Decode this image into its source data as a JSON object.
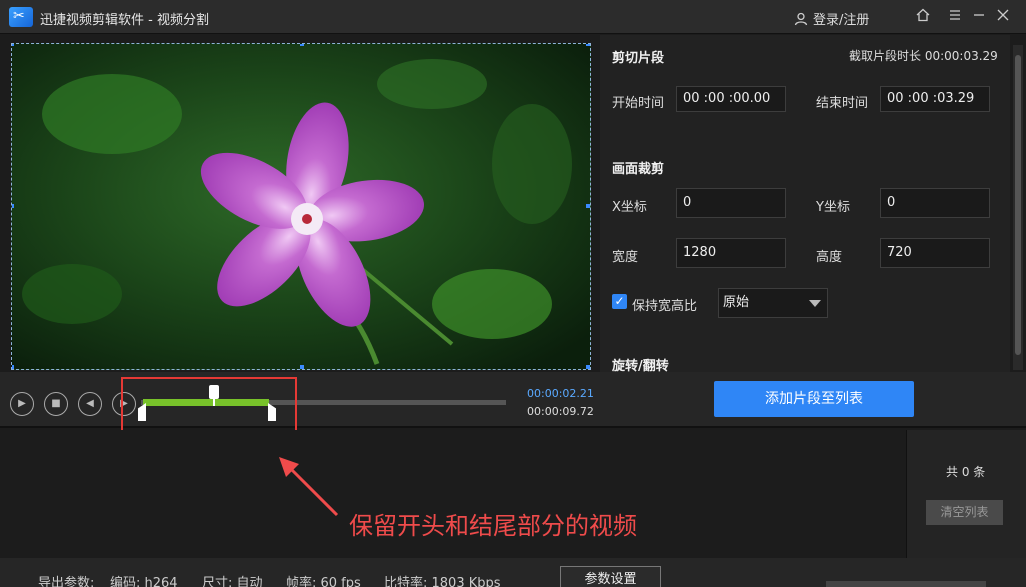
{
  "window": {
    "title": "迅捷视频剪辑软件 - 视频分割",
    "login_label": "登录/注册"
  },
  "icons": [
    "scissors-logo-icon",
    "user-icon",
    "home-icon",
    "menu-icon",
    "close-icon",
    "play-icon",
    "stop-icon",
    "prev-frame-icon",
    "next-frame-icon",
    "checkmark-icon",
    "arrow-annotation-icon"
  ],
  "clip": {
    "section_title": "剪切片段",
    "duration_label": "截取片段时长 00:00:03.29",
    "start_label": "开始时间",
    "start_value": "00 :00 :00.00",
    "end_label": "结束时间",
    "end_value": "00 :00 :03.29"
  },
  "crop": {
    "section_title": "画面裁剪",
    "x_label": "X坐标",
    "x_value": "0",
    "y_label": "Y坐标",
    "y_value": "0",
    "width_label": "宽度",
    "width_value": "1280",
    "height_label": "高度",
    "height_value": "720",
    "keep_ratio_label": "保持宽高比",
    "ratio_option": "原始"
  },
  "rotate": {
    "section_title": "旋转/翻转"
  },
  "timeline": {
    "current_time": "00:00:02.21",
    "total_time": "00:00:09.72",
    "add_button": "添加片段至列表"
  },
  "list": {
    "count": "共 0 条",
    "clear_button": "清空列表"
  },
  "annotation": "保留开头和结尾部分的视频",
  "footer": {
    "export_label": "导出参数:",
    "codec": "编码: h264",
    "size": "尺寸: 自动",
    "fps": "帧率: 60 fps",
    "bitrate": "比特率: 1803 Kbps",
    "settings_button": "参数设置"
  },
  "colors": {
    "accent": "#2f86f6",
    "selection": "#78c22a",
    "annotation": "#ef4b4b",
    "current_time": "#5aa9ff"
  }
}
